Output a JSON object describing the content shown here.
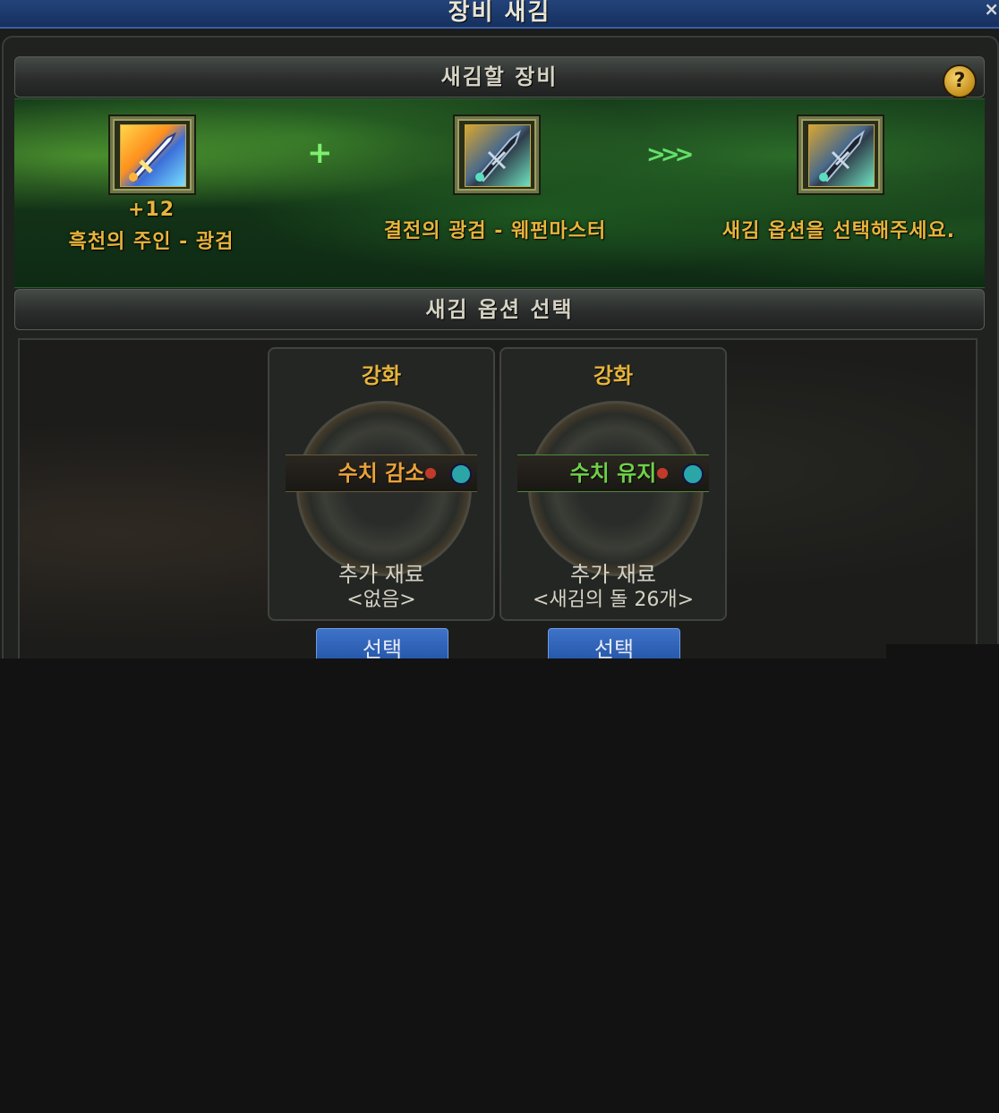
{
  "window": {
    "title": "장비 새김",
    "close_glyph": "×"
  },
  "engrave_section": {
    "header": "새김할 장비",
    "help_glyph": "?",
    "source_item": {
      "enhance_level": "+12",
      "name": "흑천의 주인 - 광검"
    },
    "plus_glyph": "+",
    "material_item": {
      "name": "결전의 광검 - 웨펀마스터"
    },
    "arrow_glyph": ">>>",
    "result_item": {
      "name": "새김 옵션을 선택해주세요."
    }
  },
  "option_section": {
    "header": "새김 옵션 선택",
    "cards": [
      {
        "title": "강화",
        "status": "수치 감소",
        "status_color": "#e9a33a",
        "material_label": "추가 재료",
        "material_value": "<없음>",
        "button_label": "선택"
      },
      {
        "title": "강화",
        "status": "수치 유지",
        "status_color": "#6fd04a",
        "material_label": "추가 재료",
        "material_value": "<새김의 돌 26개>",
        "button_label": "선택"
      }
    ]
  },
  "colors": {
    "title_bar": "#1d3b70",
    "label_gold": "#e7b53c",
    "button_blue": "#2d5fb4",
    "panel_green": "#173d1b"
  }
}
